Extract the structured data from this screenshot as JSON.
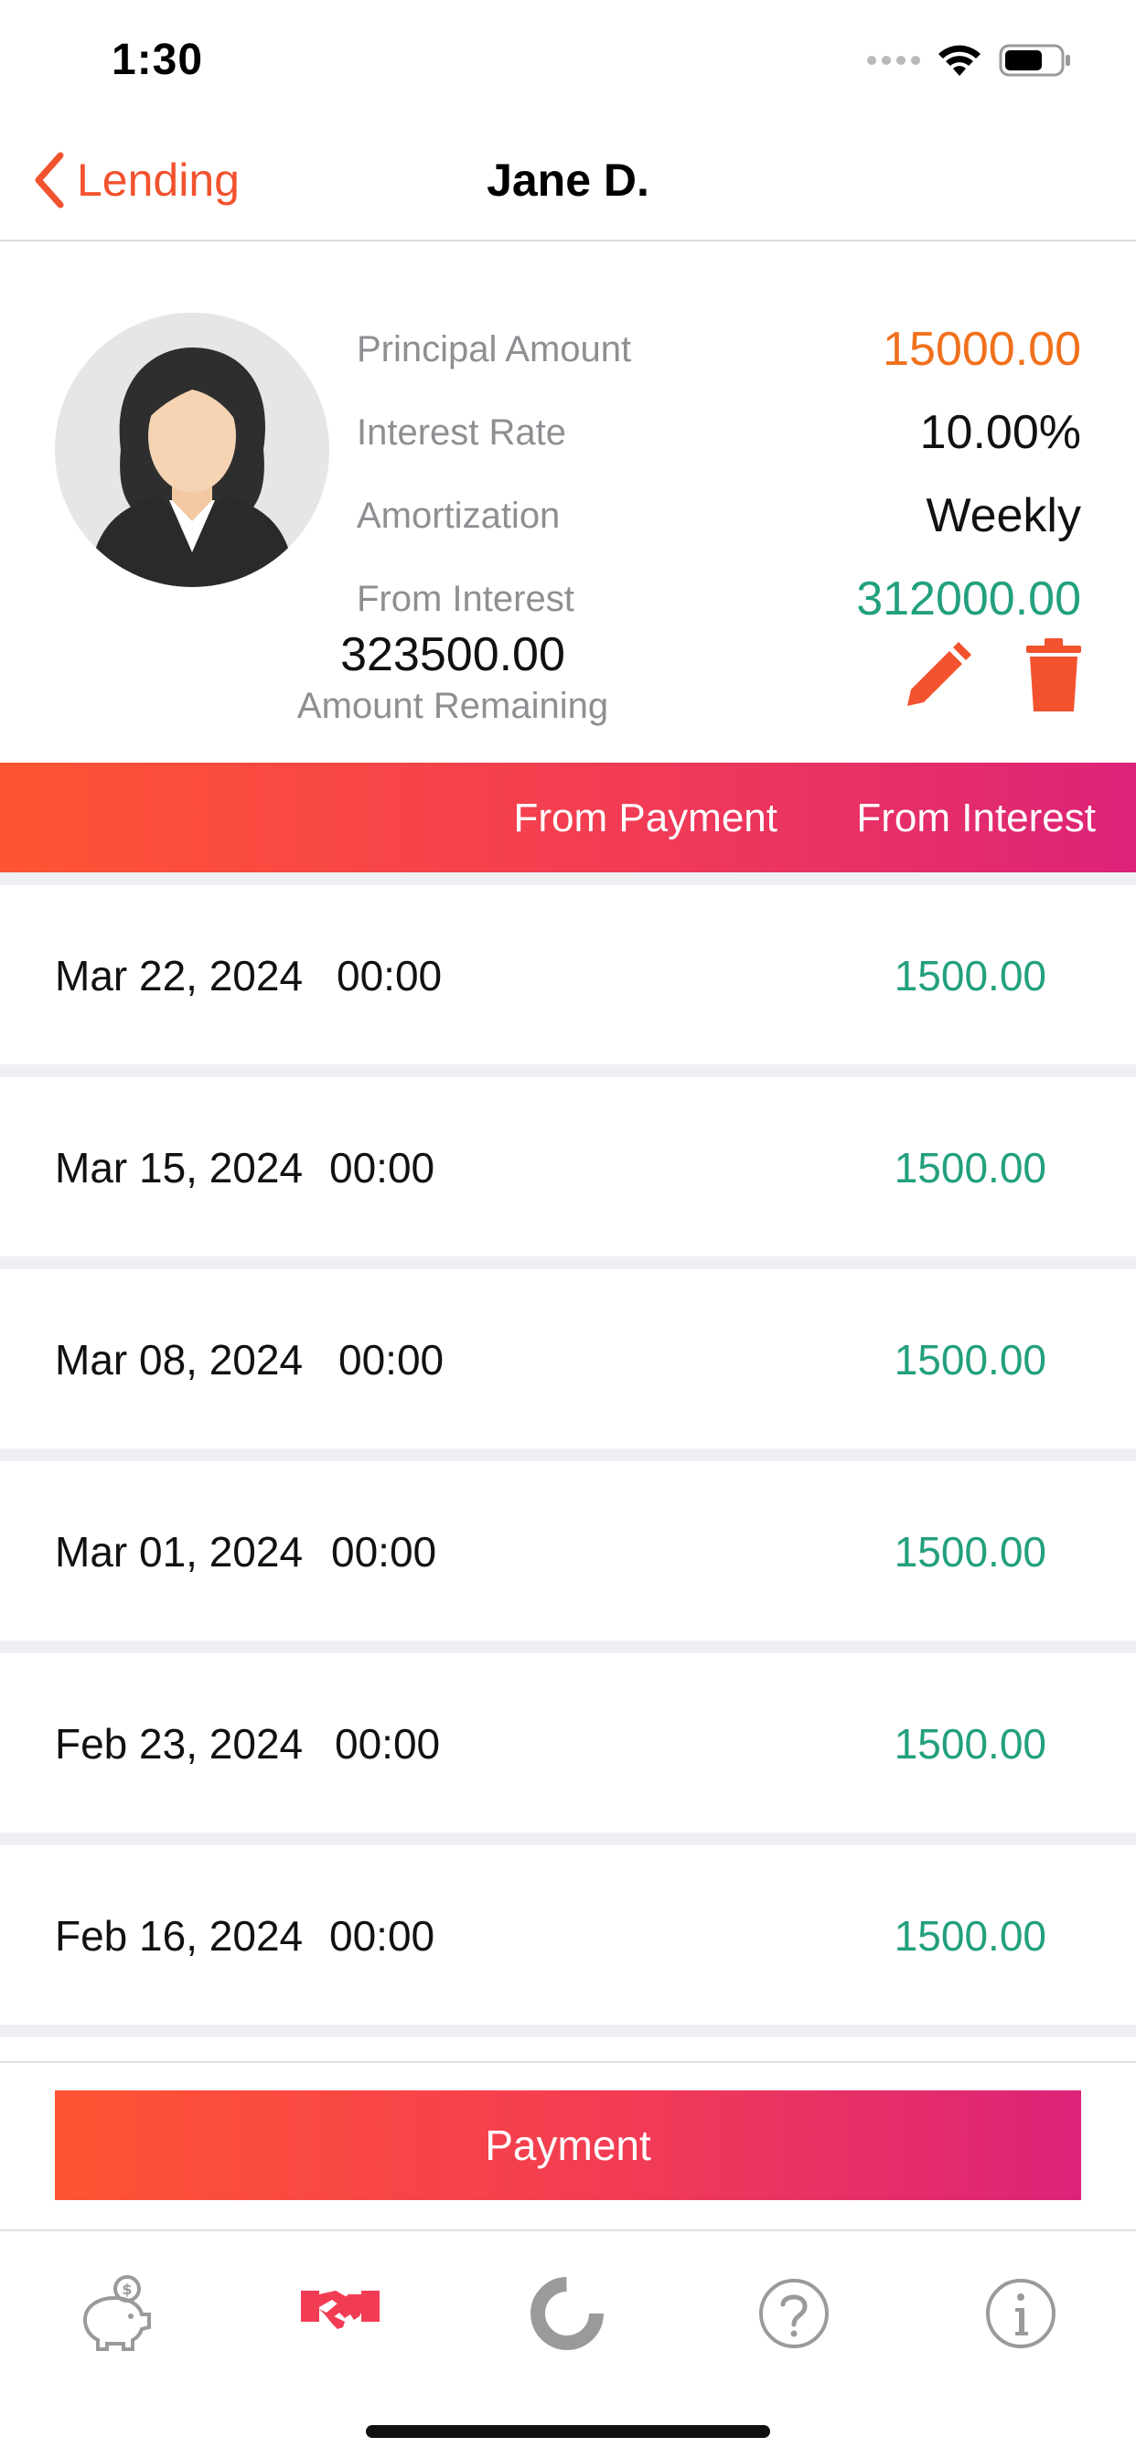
{
  "status_bar": {
    "time": "1:30"
  },
  "nav": {
    "back_label": "Lending",
    "title": "Jane D."
  },
  "summary": {
    "principal_label": "Principal Amount",
    "principal_value": "15000.00",
    "interest_rate_label": "Interest Rate",
    "interest_rate_value": "10.00%",
    "amortization_label": "Amortization",
    "amortization_value": "Weekly",
    "from_interest_label": "From Interest",
    "from_interest_value": "312000.00",
    "remaining_value": "323500.00",
    "remaining_label": "Amount Remaining"
  },
  "table_header": {
    "from_payment": "From Payment",
    "from_interest": "From Interest"
  },
  "rows": [
    {
      "date": "Mar 22, 2024",
      "time": "00:00",
      "amount": "1500.00"
    },
    {
      "date": "Mar 15, 2024",
      "time": "00:00",
      "amount": "1500.00"
    },
    {
      "date": "Mar 08, 2024",
      "time": "00:00",
      "amount": "1500.00"
    },
    {
      "date": "Mar 01, 2024",
      "time": "00:00",
      "amount": "1500.00"
    },
    {
      "date": "Feb 23, 2024",
      "time": "00:00",
      "amount": "1500.00"
    },
    {
      "date": "Feb 16, 2024",
      "time": "00:00",
      "amount": "1500.00"
    }
  ],
  "payment_button": {
    "label": "Payment"
  },
  "tabs": [
    {
      "icon": "piggy-bank-icon",
      "active": false
    },
    {
      "icon": "handshake-icon",
      "active": true
    },
    {
      "icon": "donut-chart-icon",
      "active": false
    },
    {
      "icon": "help-icon",
      "active": false
    },
    {
      "icon": "info-icon",
      "active": false
    }
  ],
  "colors": {
    "accent": "#f2522e",
    "gradient_start": "#ff5433",
    "gradient_end": "#dc2379",
    "principal": "#f0701c",
    "positive": "#23a07e",
    "inactive_icon": "#9a9a9a"
  }
}
